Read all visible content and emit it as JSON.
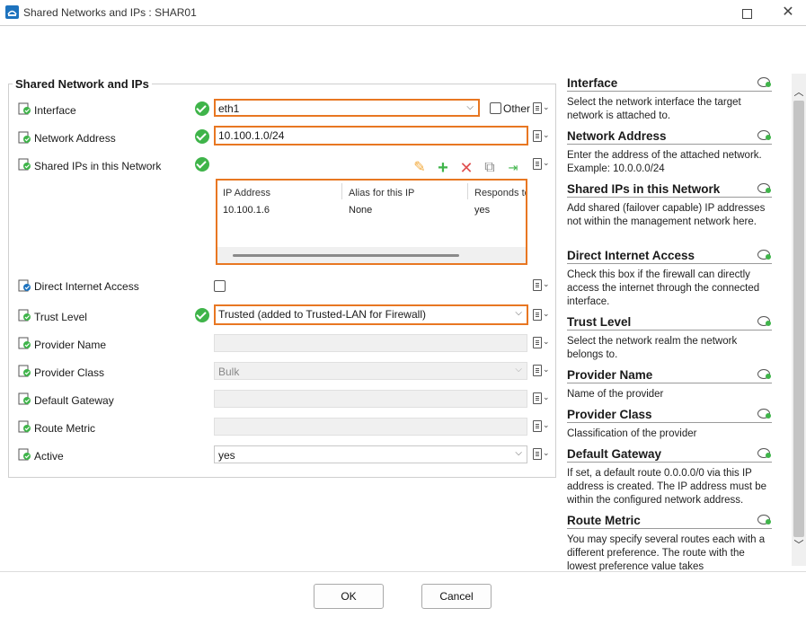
{
  "window": {
    "title": "Shared Networks and IPs : SHAR01"
  },
  "form": {
    "group_title": "Shared Network and IPs",
    "interface": {
      "label": "Interface",
      "value": "eth1",
      "other_label": "Other"
    },
    "network_address": {
      "label": "Network Address",
      "value": "10.100.1.0/24"
    },
    "shared_ips": {
      "label": "Shared IPs in this Network",
      "columns": [
        "IP Address",
        "Alias for this IP",
        "Responds to"
      ],
      "rows": [
        [
          "10.100.1.6",
          "None",
          "yes"
        ]
      ]
    },
    "direct_internet": {
      "label": "Direct Internet Access"
    },
    "trust_level": {
      "label": "Trust Level",
      "value": "Trusted (added to Trusted-LAN for Firewall)"
    },
    "provider_name": {
      "label": "Provider Name",
      "value": ""
    },
    "provider_class": {
      "label": "Provider Class",
      "value": "Bulk"
    },
    "default_gateway": {
      "label": "Default Gateway",
      "value": ""
    },
    "route_metric": {
      "label": "Route Metric",
      "value": ""
    },
    "active": {
      "label": "Active",
      "value": "yes"
    }
  },
  "help": [
    {
      "title": "Interface",
      "text": "Select the network interface the target network is attached to."
    },
    {
      "title": "Network Address",
      "text": "Enter the address of the attached network. Example: 10.0.0.0/24"
    },
    {
      "title": "Shared IPs in this Network",
      "text": "Add shared (failover capable) IP addresses not within the management network here."
    },
    {
      "title": "Direct Internet Access",
      "text": "Check this box if the firewall can directly access the internet through the connected interface."
    },
    {
      "title": "Trust Level",
      "text": "Select the network realm the network belongs to."
    },
    {
      "title": "Provider Name",
      "text": "Name of the provider"
    },
    {
      "title": "Provider Class",
      "text": "Classification of the provider"
    },
    {
      "title": "Default Gateway",
      "text": "If set, a default route 0.0.0.0/0 via this IP address is created. The IP address must be within the configured network address."
    },
    {
      "title": "Route Metric",
      "text": "You may specify several routes each with a different preference. The route with the lowest preference value takes"
    }
  ],
  "buttons": {
    "ok": "OK",
    "cancel": "Cancel"
  },
  "colors": {
    "highlight": "#e87722",
    "ok_green": "#3fb44a"
  }
}
